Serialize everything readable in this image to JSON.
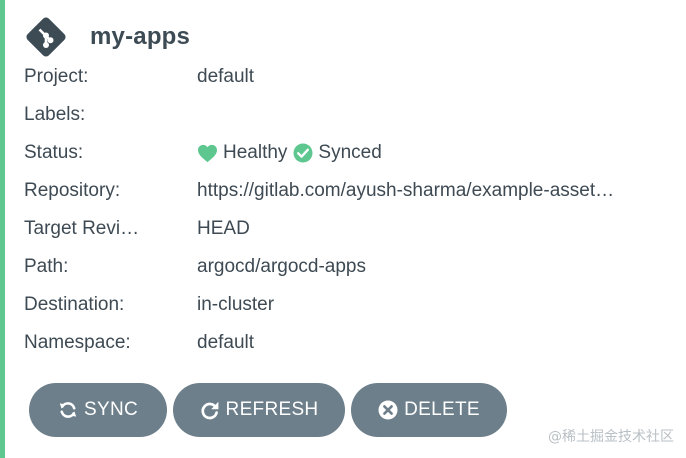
{
  "app": {
    "title": "my-apps",
    "icon": "git-icon"
  },
  "fields": [
    {
      "label": "Project:",
      "value": "default"
    },
    {
      "label": "Labels:",
      "value": ""
    },
    {
      "label": "Status:",
      "value": ""
    },
    {
      "label": "Repository:",
      "value": "https://gitlab.com/ayush-sharma/example-asset…"
    },
    {
      "label": "Target Revi…",
      "value": "HEAD"
    },
    {
      "label": "Path:",
      "value": "argocd/argocd-apps"
    },
    {
      "label": "Destination:",
      "value": "in-cluster"
    },
    {
      "label": "Namespace:",
      "value": "default"
    }
  ],
  "status": {
    "health": "Healthy",
    "health_icon": "heart-icon",
    "sync": "Synced",
    "sync_icon": "check-circle-icon",
    "color": "#5ec68f"
  },
  "actions": {
    "sync_label": "SYNC",
    "refresh_label": "REFRESH",
    "delete_label": "DELETE"
  },
  "watermark": "@稀土掘金技术社区",
  "colors": {
    "accent": "#5ec68f",
    "button": "#6d7f8b",
    "text": "#3e4a53"
  }
}
